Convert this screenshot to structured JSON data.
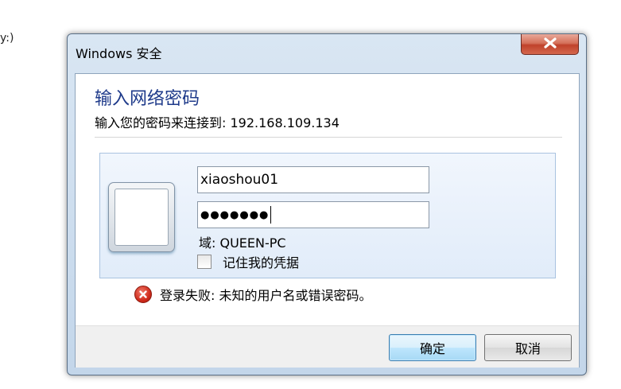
{
  "background": {
    "fragment_text": "y:)"
  },
  "dialog": {
    "title": "Windows 安全",
    "close_icon": "close-x-icon",
    "heading": "输入网络密码",
    "subtext": "输入您的密码来连接到: 192.168.109.134",
    "username_value": "xiaoshou01",
    "password_masked": "●●●●●●●",
    "domain_label": "域: QUEEN-PC",
    "remember_label": "记住我的凭据",
    "remember_checked": false,
    "error_icon": "error-circle-x-icon",
    "error_text": "登录失败: 未知的用户名或错误密码。",
    "ok_label": "确定",
    "cancel_label": "取消"
  },
  "colors": {
    "heading": "#1e3a8a",
    "close_button": "#c0422b",
    "error_icon": "#d02c1c",
    "default_button_border": "#3c7fb1"
  }
}
